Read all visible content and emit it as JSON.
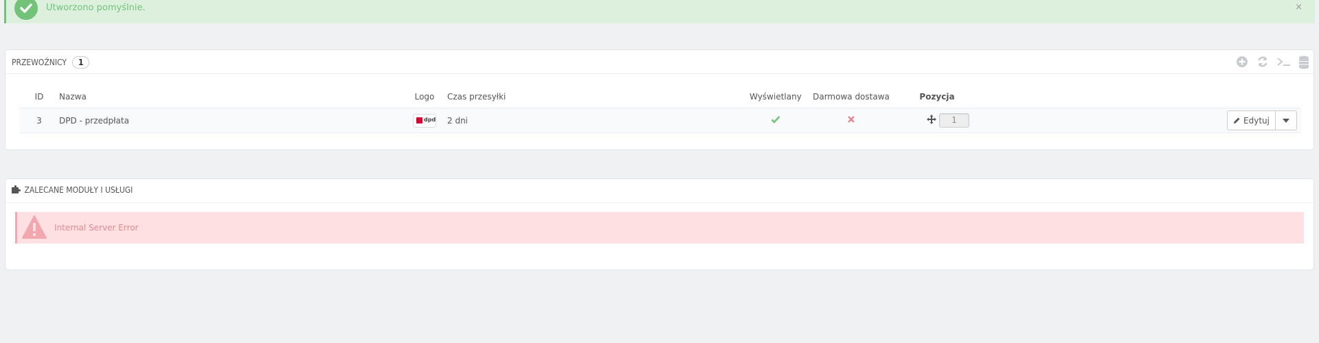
{
  "success_alert": {
    "message": "Utworzono pomyślnie.",
    "close_symbol": "×"
  },
  "carriers_panel": {
    "title": "PRZEWOŹNICY",
    "count": "1",
    "toolbar": [
      "add-new-icon",
      "refresh-icon",
      "sql-query-icon",
      "export-db-icon"
    ],
    "columns": {
      "id": "ID",
      "name": "Nazwa",
      "logo": "Logo",
      "delay": "Czas przesyłki",
      "active": "Wyświetlany",
      "free": "Darmowa dostawa",
      "position": "Pozycja"
    },
    "rows": [
      {
        "id": "3",
        "name": "DPD - przedpłata",
        "logo_text": "dpd",
        "delay": "2 dni",
        "active": true,
        "free": false,
        "position": "1",
        "edit_label": "Edytuj"
      }
    ]
  },
  "modules_panel": {
    "title": "ZALECANE MODUŁY I USŁUGI",
    "error": "Internal Server Error"
  },
  "colors": {
    "success": "#72c279",
    "danger": "#e08a93",
    "dpd_red": "#dc0032"
  }
}
